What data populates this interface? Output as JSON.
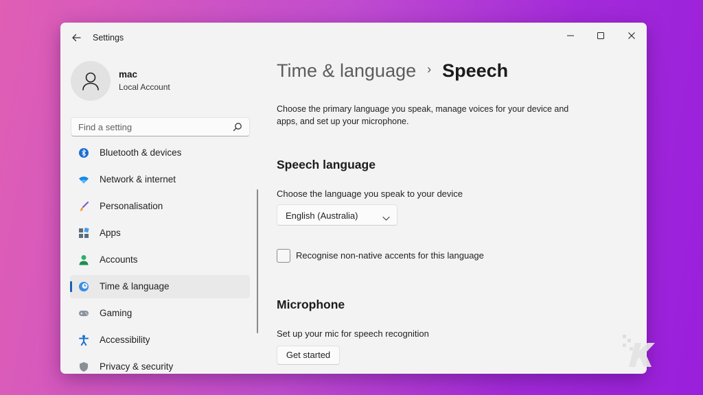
{
  "window": {
    "title": "Settings"
  },
  "profile": {
    "name": "mac",
    "account_type": "Local Account"
  },
  "search": {
    "placeholder": "Find a setting"
  },
  "sidebar": {
    "items": [
      {
        "label": "Bluetooth & devices",
        "icon": "bluetooth-icon"
      },
      {
        "label": "Network & internet",
        "icon": "wifi-icon"
      },
      {
        "label": "Personalisation",
        "icon": "brush-icon"
      },
      {
        "label": "Apps",
        "icon": "apps-icon"
      },
      {
        "label": "Accounts",
        "icon": "person-icon"
      },
      {
        "label": "Time & language",
        "icon": "globe-clock-icon",
        "selected": true
      },
      {
        "label": "Gaming",
        "icon": "gamepad-icon"
      },
      {
        "label": "Accessibility",
        "icon": "accessibility-icon"
      },
      {
        "label": "Privacy & security",
        "icon": "shield-icon"
      }
    ]
  },
  "main": {
    "breadcrumb": {
      "parent": "Time & language",
      "separator": "›",
      "current": "Speech"
    },
    "description": "Choose the primary language you speak, manage voices for your device and apps, and set up your microphone.",
    "speech_language": {
      "title": "Speech language",
      "label": "Choose the language you speak to your device",
      "selected": "English (Australia)",
      "checkbox_label": "Recognise non-native accents for this language",
      "checkbox_checked": false
    },
    "microphone": {
      "title": "Microphone",
      "label": "Set up your mic for speech recognition",
      "button": "Get started"
    }
  },
  "colors": {
    "accent": "#1a5fb4",
    "window_bg": "#f3f3f3"
  }
}
